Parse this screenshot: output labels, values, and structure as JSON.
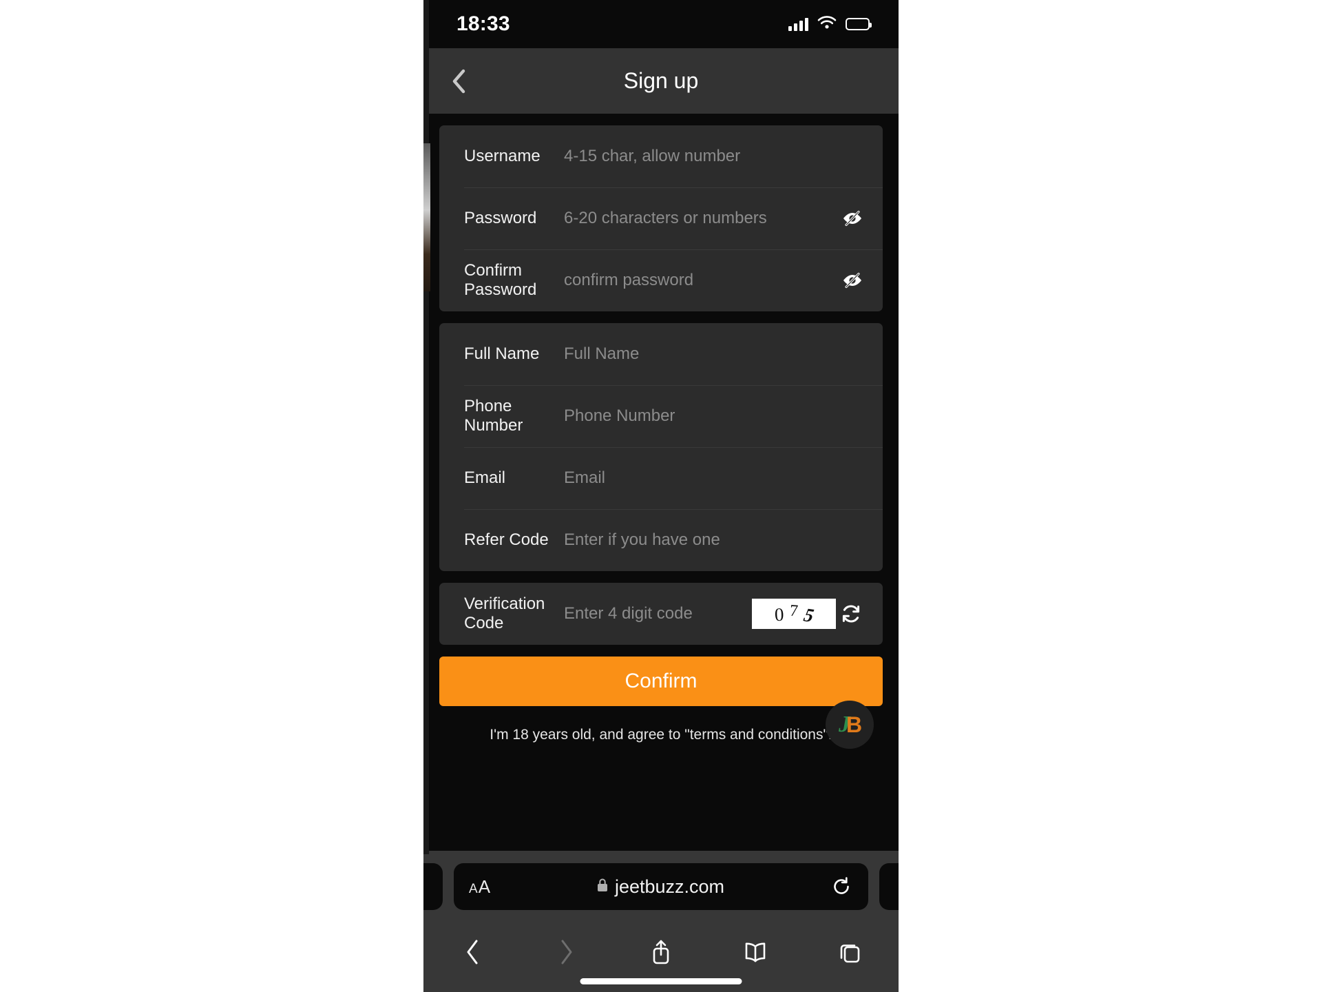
{
  "status_bar": {
    "time": "18:33",
    "signal_icon": "cellular-signal-icon",
    "wifi_icon": "wifi-icon",
    "battery_icon": "battery-icon"
  },
  "app_header": {
    "back_icon": "chevron-left-icon",
    "title": "Sign up"
  },
  "form": {
    "account_card": [
      {
        "label": "Username",
        "placeholder": "4-15 char, allow number",
        "value": "",
        "toggle": null
      },
      {
        "label": "Password",
        "placeholder": "6-20 characters or numbers",
        "value": "",
        "toggle": "eye-off-icon"
      },
      {
        "label": "Confirm Password",
        "placeholder": "confirm password",
        "value": "",
        "toggle": "eye-off-icon"
      }
    ],
    "profile_card": [
      {
        "label": "Full Name",
        "placeholder": "Full Name",
        "value": ""
      },
      {
        "label": "Phone Number",
        "placeholder": "Phone Number",
        "value": ""
      },
      {
        "label": "Email",
        "placeholder": "Email",
        "value": ""
      },
      {
        "label": "Refer Code",
        "placeholder": "Enter if you have one",
        "value": ""
      }
    ],
    "verification": {
      "label": "Verification Code",
      "placeholder": "Enter 4 digit code",
      "value": "",
      "captcha_digits": [
        "0",
        "7",
        "5"
      ],
      "captcha_text": "075",
      "refresh_icon": "refresh-icon"
    },
    "submit_label": "Confirm",
    "terms_text": "I'm 18 years old, and agree to \"terms and conditions\"."
  },
  "floating_badge": {
    "name": "jeetbuzz-logo-badge",
    "letter_1": "J",
    "letter_2": "B"
  },
  "browser": {
    "text_size_label_small": "A",
    "text_size_label_large": "A",
    "lock_icon": "lock-icon",
    "url": "jeetbuzz.com",
    "reload_icon": "reload-icon",
    "toolbar": {
      "back_icon": "back-arrow-icon",
      "forward_icon": "forward-arrow-icon",
      "share_icon": "share-icon",
      "bookmarks_icon": "book-icon",
      "tabs_icon": "tabs-icon"
    }
  },
  "colors": {
    "accent_orange": "#fa9016",
    "card_bg": "#2c2c2c",
    "page_bg": "#0a0a0a",
    "chrome_bg": "#373737",
    "header_bg": "#333333"
  }
}
